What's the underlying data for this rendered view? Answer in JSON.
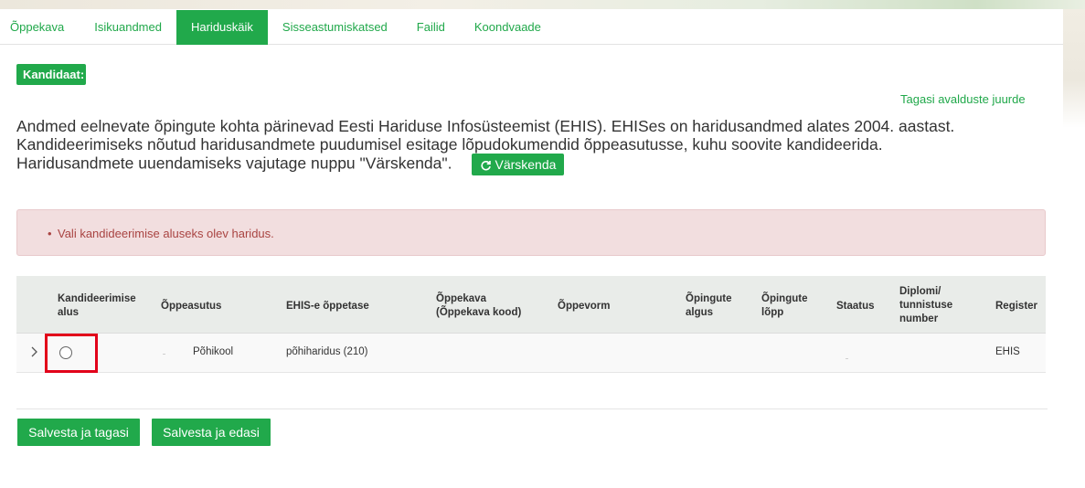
{
  "tabs": [
    {
      "label": "Õppekava",
      "active": false
    },
    {
      "label": "Isikuandmed",
      "active": false
    },
    {
      "label": "Hariduskäik",
      "active": true
    },
    {
      "label": "Sisseastumiskatsed",
      "active": false
    },
    {
      "label": "Failid",
      "active": false
    },
    {
      "label": "Koondvaade",
      "active": false
    }
  ],
  "candidate_label": "Kandidaat:",
  "back_link": "Tagasi avalduste juurde",
  "info": {
    "line1": "Andmed eelnevate õpingute kohta pärinevad Eesti Hariduse Infosüsteemist (EHIS). EHISes on haridusandmed alates 2004. aastast.",
    "line2": "Kandideerimiseks nõutud haridusandmete puudumisel esitage lõpudokumendid õppeasutusse, kuhu soovite kandideerida.",
    "line3": "Haridusandmete uuendamiseks vajutage nuppu \"Värskenda\".",
    "refresh_button": "Värskenda"
  },
  "alert": {
    "message": "Vali kandideerimise aluseks olev haridus."
  },
  "table": {
    "headers": {
      "basis": "Kandideerimise alus",
      "institution": "Õppeasutus",
      "level": "EHIS-e õppetase",
      "curriculum": "Õppekava (Õppekava kood)",
      "form": "Õppevorm",
      "start": "Õpingute algus",
      "end": "Õpingute lõpp",
      "status": "Staatus",
      "diploma": "Diplomi/ tunnistuse number",
      "register": "Register"
    },
    "rows": [
      {
        "selected": false,
        "institution": "Põhikool",
        "level": "põhiharidus (210)",
        "curriculum": "",
        "form": "",
        "start": "",
        "end": "",
        "status": "",
        "diploma": "",
        "register": "EHIS"
      }
    ]
  },
  "buttons": {
    "save_back": "Salvesta ja tagasi",
    "save_next": "Salvesta ja edasi"
  },
  "colors": {
    "accent": "#21a94b",
    "alert_bg": "#f2dedf",
    "alert_text": "#a94442",
    "highlight": "#e2001a"
  },
  "icons": {
    "refresh": "refresh-icon",
    "expand": "chevron-right-icon"
  }
}
